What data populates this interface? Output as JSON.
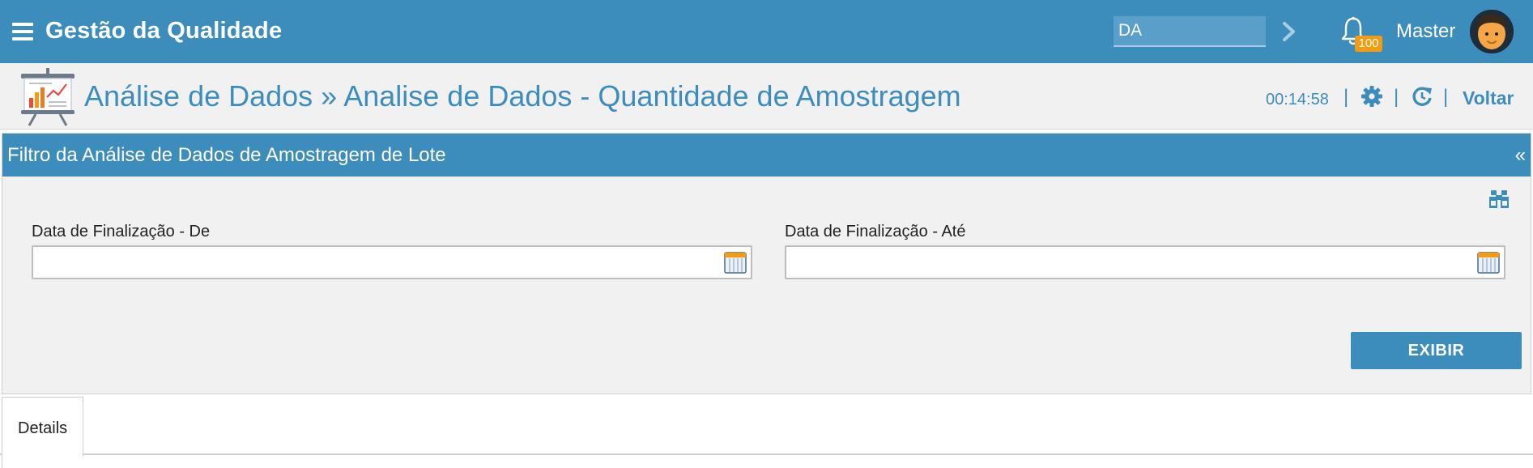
{
  "header": {
    "app_title": "Gestão da Qualidade",
    "search_value": "DA",
    "notification_count": "100",
    "user_name": "Master"
  },
  "page": {
    "title": "Análise de Dados » Analise de Dados - Quantidade de Amostragem",
    "timer": "00:14:58",
    "separator": "|",
    "back_label": "Voltar"
  },
  "filter": {
    "title": "Filtro da Análise de Dados de Amostragem de Lote",
    "collapse_symbol": "«",
    "fields": [
      {
        "label": "Data de Finalização - De",
        "value": ""
      },
      {
        "label": "Data de Finalização - Até",
        "value": ""
      }
    ],
    "submit_label": "EXIBIR"
  },
  "tabs": [
    {
      "label": "Details"
    }
  ],
  "colors": {
    "primary": "#3c8dbc",
    "badge": "#f39c12",
    "panel_bg": "#f1f1f1"
  },
  "icons": [
    "menu-icon",
    "chevron-right-icon",
    "bell-icon",
    "avatar",
    "presentation-chart-icon",
    "gear-icon",
    "refresh-icon",
    "binoculars-icon",
    "calendar-icon"
  ]
}
